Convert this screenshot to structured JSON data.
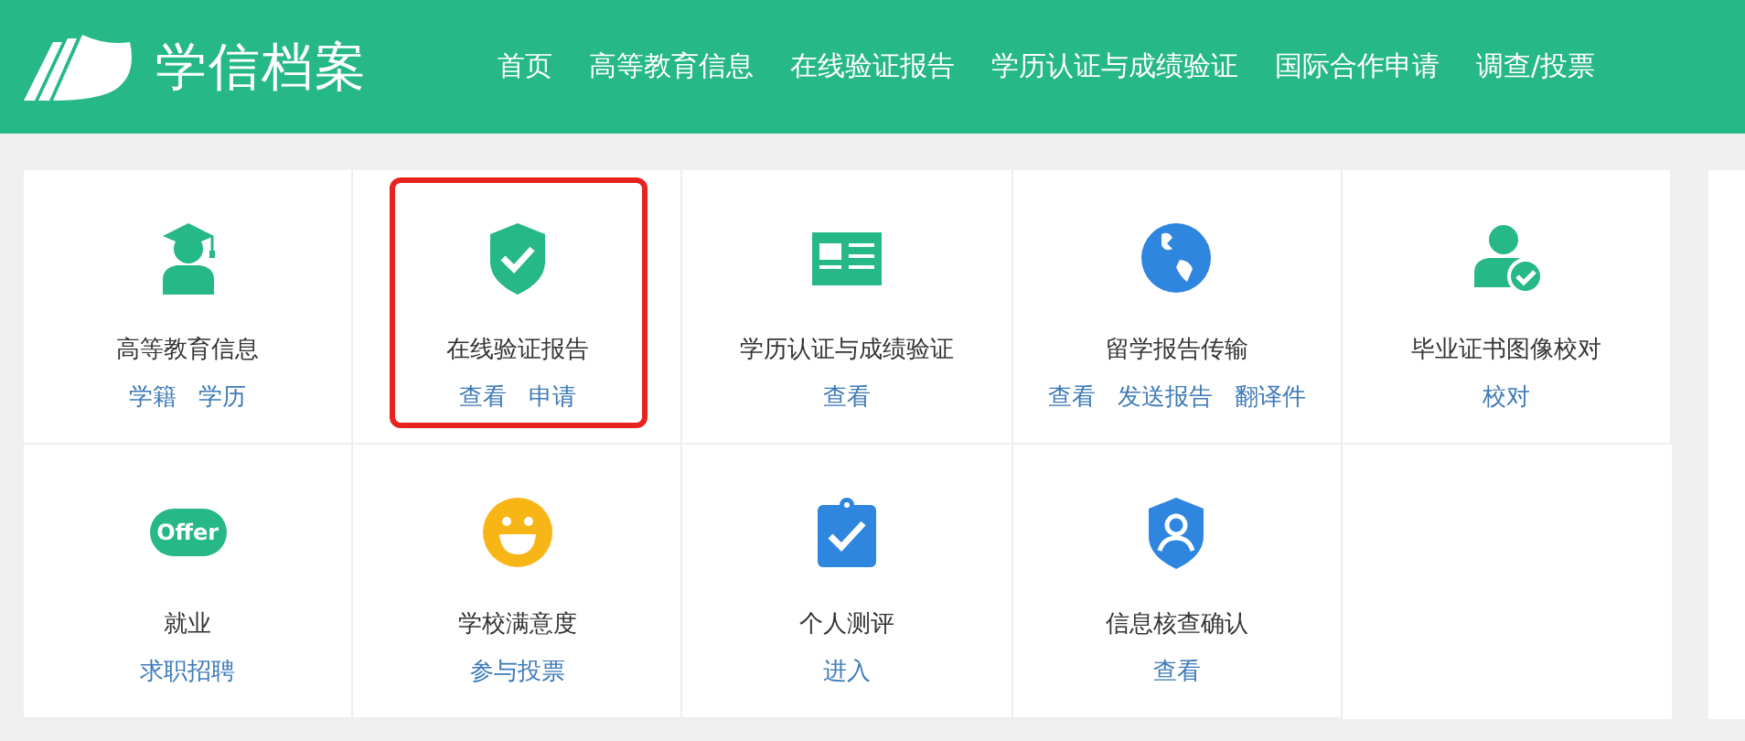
{
  "header": {
    "logo_text": "学信档案",
    "nav": [
      {
        "label": "首页"
      },
      {
        "label": "高等教育信息"
      },
      {
        "label": "在线验证报告"
      },
      {
        "label": "学历认证与成绩验证"
      },
      {
        "label": "国际合作申请"
      },
      {
        "label": "调查/投票"
      }
    ]
  },
  "tiles": [
    {
      "kind": "graduate",
      "title": "高等教育信息",
      "links": [
        "学籍",
        "学历"
      ],
      "highlighted": false
    },
    {
      "kind": "shield-check",
      "title": "在线验证报告",
      "links": [
        "查看",
        "申请"
      ],
      "highlighted": true
    },
    {
      "kind": "id-card",
      "title": "学历认证与成绩验证",
      "links": [
        "查看"
      ],
      "highlighted": false
    },
    {
      "kind": "globe",
      "title": "留学报告传输",
      "links": [
        "查看",
        "发送报告",
        "翻译件"
      ],
      "highlighted": false
    },
    {
      "kind": "user-check",
      "title": "毕业证书图像校对",
      "links": [
        "校对"
      ],
      "highlighted": false
    },
    {
      "kind": "offer",
      "icon_text": "Offer",
      "title": "就业",
      "links": [
        "求职招聘"
      ],
      "highlighted": false
    },
    {
      "kind": "smiley",
      "title": "学校满意度",
      "links": [
        "参与投票"
      ],
      "highlighted": false
    },
    {
      "kind": "clipboard-check",
      "title": "个人测评",
      "links": [
        "进入"
      ],
      "highlighted": false
    },
    {
      "kind": "user-shield",
      "title": "信息核查确认",
      "links": [
        "查看"
      ],
      "highlighted": false
    }
  ]
}
